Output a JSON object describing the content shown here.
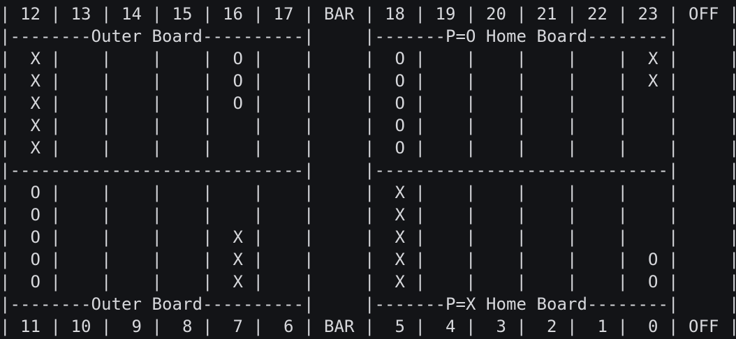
{
  "terminal": {
    "lines": [
      "| 12 | 13 | 14 | 15 | 16 | 17 | BAR | 18 | 19 | 20 | 21 | 22 | 23 | OFF |",
      "|--------Outer Board----------|     |-------P=O Home Board--------|     |",
      "|  X |    |    |    |  O |    |     |  O |    |    |    |    |  X |     |",
      "|  X |    |    |    |  O |    |     |  O |    |    |    |    |  X |     |",
      "|  X |    |    |    |  O |    |     |  O |    |    |    |    |    |     |",
      "|  X |    |    |    |    |    |     |  O |    |    |    |    |    |     |",
      "|  X |    |    |    |    |    |     |  O |    |    |    |    |    |     |",
      "|-----------------------------|     |-----------------------------|     |",
      "|  O |    |    |    |    |    |     |  X |    |    |    |    |    |     |",
      "|  O |    |    |    |    |    |     |  X |    |    |    |    |    |     |",
      "|  O |    |    |    |  X |    |     |  X |    |    |    |    |    |     |",
      "|  O |    |    |    |  X |    |     |  X |    |    |    |    |  O |     |",
      "|  O |    |    |    |  X |    |     |  X |    |    |    |    |  O |     |",
      "|--------Outer Board----------|     |-------P=X Home Board--------|     |",
      "| 11 | 10 |  9 |  8 |  7 |  6 | BAR |  5 |  4 |  3 |  2 |  1 |  0 | OFF |"
    ]
  },
  "colors": {
    "background": "#131417",
    "foreground": "#d7d8dc"
  }
}
